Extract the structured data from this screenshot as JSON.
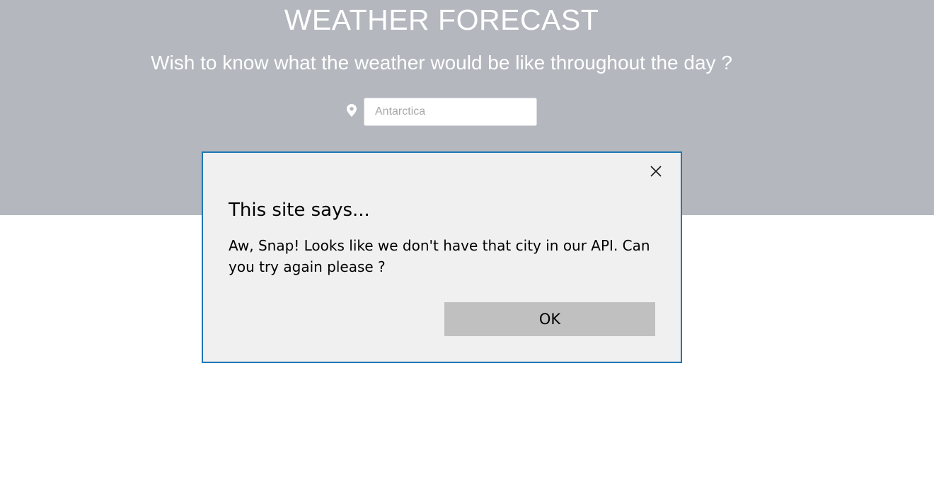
{
  "header": {
    "title": "WEATHER FORECAST",
    "subtitle": "Wish to know what the weather would be like throughout the day ?"
  },
  "search": {
    "icon": "map-pin-icon",
    "placeholder": "Antarctica",
    "value": ""
  },
  "dialog": {
    "heading": "This site says...",
    "message": "Aw, Snap! Looks like we don't have that city in our API. Can you try again please ?",
    "ok_label": "OK",
    "close_icon": "close-icon"
  },
  "colors": {
    "banner": "#b4b7be",
    "dialog_border": "#1f78b4",
    "dialog_background": "#f0f0f0",
    "button_background": "#c0c0c0"
  }
}
